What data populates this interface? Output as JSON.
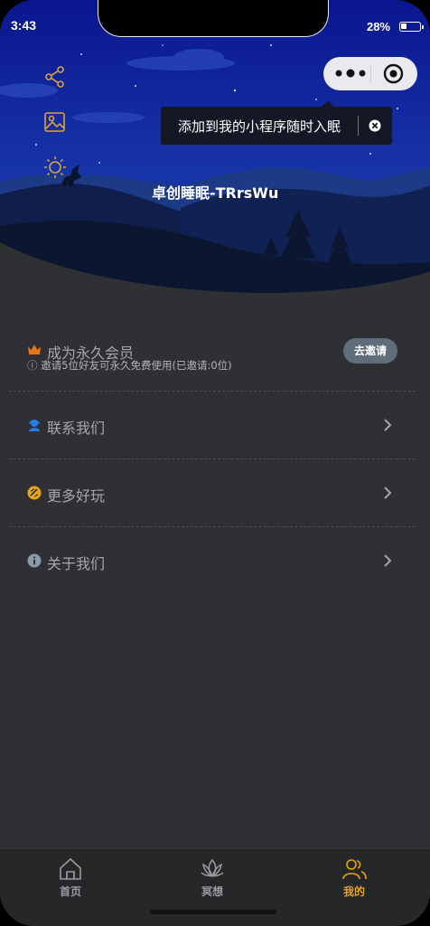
{
  "status_bar": {
    "time": "3:43",
    "battery": "28%"
  },
  "capsule": {
    "more_icon": "ellipsis-icon",
    "close_icon": "target-icon"
  },
  "tooltip": {
    "text": "添加到我的小程序随时入眠"
  },
  "header": {
    "username": "卓创睡眠-TRrsWu"
  },
  "side_actions": [
    {
      "icon": "share-icon"
    },
    {
      "icon": "image-icon"
    },
    {
      "icon": "brightness-icon"
    }
  ],
  "membership": {
    "title": "成为永久会员",
    "subtitle": "ⓘ 邀请5位好友可永久免费使用(已邀请:0位)",
    "button": "去邀请"
  },
  "menu": [
    {
      "label": "联系我们",
      "icon": "customer-service-icon"
    },
    {
      "label": "更多好玩",
      "icon": "fun-icon"
    },
    {
      "label": "关于我们",
      "icon": "info-icon"
    }
  ],
  "tabbar": [
    {
      "label": "首页",
      "icon": "home-icon"
    },
    {
      "label": "冥想",
      "icon": "lotus-icon"
    },
    {
      "label": "我的",
      "icon": "profile-icon",
      "active": true
    }
  ],
  "colors": {
    "accent": "#e5a51b",
    "background": "#2f3033",
    "sky_top": "#0d1a8a"
  }
}
